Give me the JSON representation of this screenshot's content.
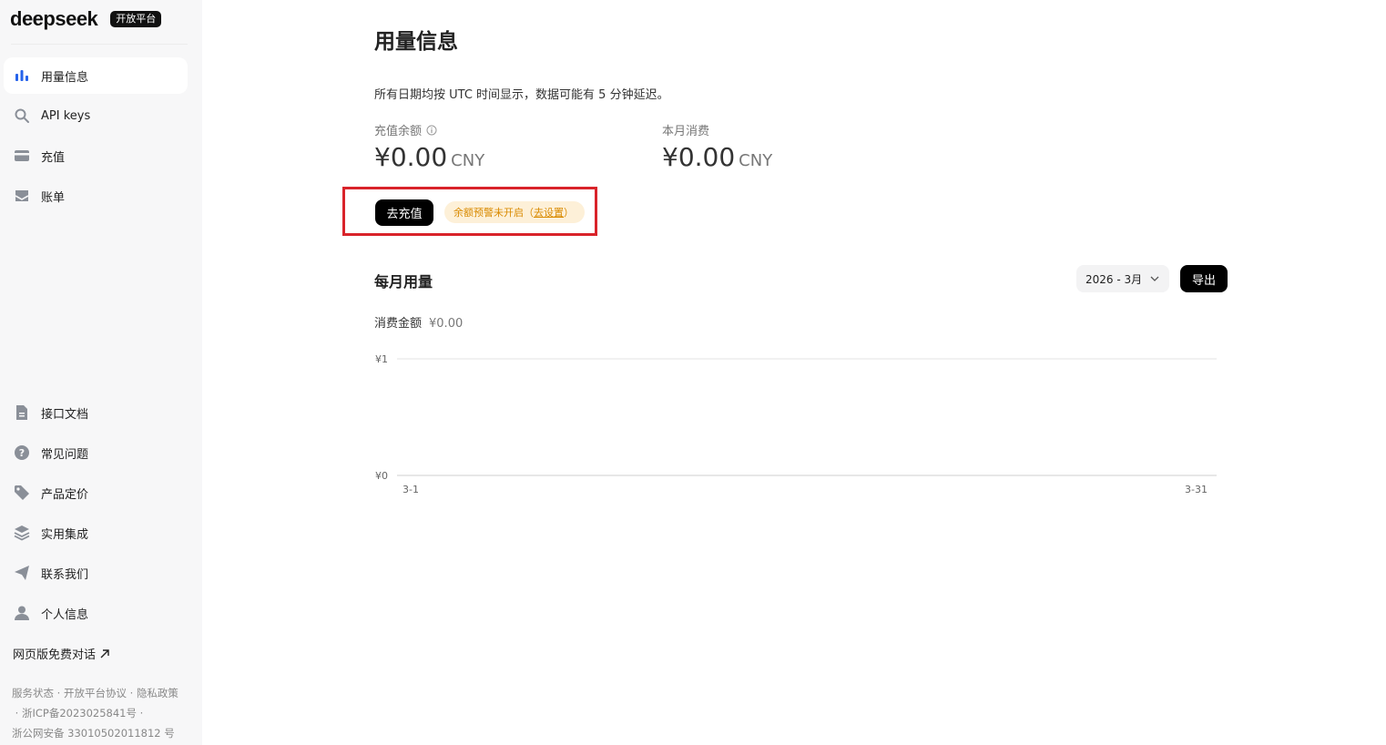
{
  "brand": {
    "logo": "deepseek",
    "badge": "开放平台"
  },
  "sidebar": {
    "top_items": [
      {
        "label": "用量信息",
        "icon": "bar-chart-icon",
        "active": true
      },
      {
        "label": "API keys",
        "icon": "search-icon"
      },
      {
        "label": "充值",
        "icon": "wallet-icon"
      },
      {
        "label": "账单",
        "icon": "inbox-icon"
      }
    ],
    "bottom_items": [
      {
        "label": "接口文档",
        "icon": "document-icon"
      },
      {
        "label": "常见问题",
        "icon": "question-icon"
      },
      {
        "label": "产品定价",
        "icon": "tag-icon"
      },
      {
        "label": "实用集成",
        "icon": "layers-icon"
      },
      {
        "label": "联系我们",
        "icon": "send-icon"
      },
      {
        "label": "个人信息",
        "icon": "user-icon"
      }
    ],
    "web_chat": "网页版免费对话",
    "footer": {
      "service_status": "服务状态",
      "platform_agreement": "开放平台协议",
      "privacy_policy": "隐私政策",
      "icp": "浙ICP备2023025841号",
      "police": "浙公网安备 33010502011812 号"
    }
  },
  "main": {
    "title": "用量信息",
    "notice": "所有日期均按 UTC 时间显示，数据可能有 5 分钟延迟。",
    "balance": {
      "label": "充值余额",
      "value": "¥0.00",
      "unit": "CNY"
    },
    "monthly_spend": {
      "label": "本月消费",
      "value": "¥0.00",
      "unit": "CNY"
    },
    "recharge_button": "去充值",
    "alert": {
      "text": "余额预警未开启（",
      "link": "去设置",
      "suffix": "）"
    },
    "monthly_usage": {
      "title": "每月用量",
      "month_select": "2026 - 3月",
      "export_button": "导出",
      "spend_label": "消费金额",
      "spend_value": "¥0.00"
    },
    "highlight_color": "#d9232a"
  },
  "chart_data": {
    "type": "line",
    "x_tick_labels": [
      "3-1",
      "3-31"
    ],
    "y_tick_labels": [
      "¥1",
      "¥0"
    ],
    "ylim": [
      0,
      1
    ],
    "series": [
      {
        "values": []
      }
    ],
    "grid": true
  }
}
